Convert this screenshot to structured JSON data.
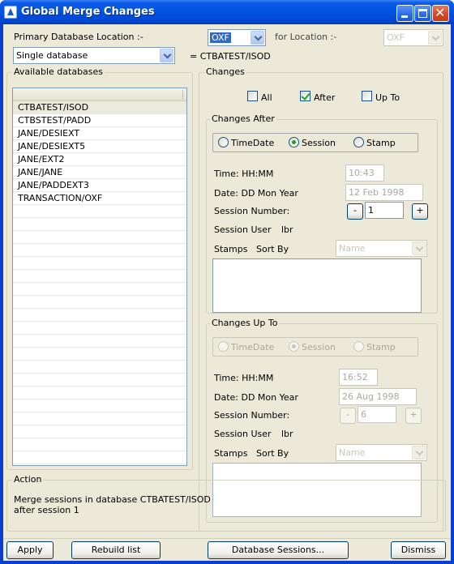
{
  "window": {
    "title": "Global Merge Changes",
    "controls": {
      "minimize": "minimize",
      "maximize": "maximize",
      "close": "close"
    }
  },
  "primary": {
    "label": "Primary Database Location :-",
    "location_value": "OXF",
    "for_location_label": "for Location :-",
    "for_location_value": "OXF",
    "mode_value": "Single database",
    "db_display": "= CTBATEST/ISOD"
  },
  "available": {
    "title": "Available databases",
    "items": [
      "CTBATEST/ISOD",
      "CTBSTEST/PADD",
      "JANE/DESIEXT",
      "JANE/DESIEXT5",
      "JANE/EXT2",
      "JANE/JANE",
      "JANE/PADDEXT3",
      "TRANSACTION/OXF"
    ],
    "selected": "CTBATEST/ISOD"
  },
  "changes": {
    "title": "Changes",
    "all_label": "All",
    "after_label": "After",
    "upto_label": "Up To"
  },
  "changes_after": {
    "title": "Changes After",
    "radio_timedate": "TimeDate",
    "radio_session": "Session",
    "radio_stamp": "Stamp",
    "time_label": "Time: HH:MM",
    "time_value": "10:43",
    "date_label": "Date: DD Mon Year",
    "date_value": "12 Feb 1998",
    "session_label": "Session Number:",
    "minus_label": "-",
    "session_value": "1",
    "plus_label": "+",
    "session_user_label": "Session User",
    "session_user_value": "lbr",
    "stamps_label": "Stamps",
    "sort_by_label": "Sort By",
    "sort_value": "Name"
  },
  "changes_upto": {
    "title": "Changes Up To",
    "radio_timedate": "TimeDate",
    "radio_session": "Session",
    "radio_stamp": "Stamp",
    "time_label": "Time: HH:MM",
    "time_value": "16:52",
    "date_label": "Date: DD Mon Year",
    "date_value": "26 Aug 1998",
    "session_label": "Session Number:",
    "minus_label": "-",
    "session_value": "6",
    "plus_label": "+",
    "session_user_label": "Session User",
    "session_user_value": "lbr",
    "stamps_label": "Stamps",
    "sort_by_label": "Sort By",
    "sort_value": "Name"
  },
  "action": {
    "title": "Action",
    "line1": "Merge sessions in database CTBATEST/ISOD",
    "line2": "after session 1"
  },
  "buttons": {
    "apply": "Apply",
    "rebuild": "Rebuild list",
    "db_sessions": "Database Sessions...",
    "dismiss": "Dismiss"
  }
}
